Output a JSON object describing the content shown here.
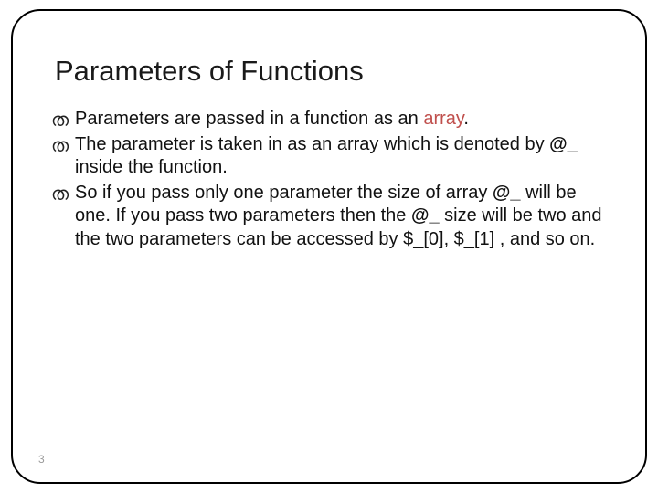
{
  "title": "Parameters of Functions",
  "bullets": [
    {
      "pre": "Parameters are passed in a function as an ",
      "kw": "array",
      "post": "."
    },
    {
      "pre": "The parameter is taken in as an array which is denoted by ",
      "bold1": "@_",
      "post1": " inside the function."
    },
    {
      "pre": "So if you pass only one parameter the size of array ",
      "bold1": "@_",
      "mid1": " will be one. If you pass two parameters then the ",
      "bold2": "@_",
      "mid2": " size will be two and the two parameters can be accessed by $_[0], $_[1] , and so on."
    }
  ],
  "page_number": "3",
  "bullet_glyph": "ത"
}
